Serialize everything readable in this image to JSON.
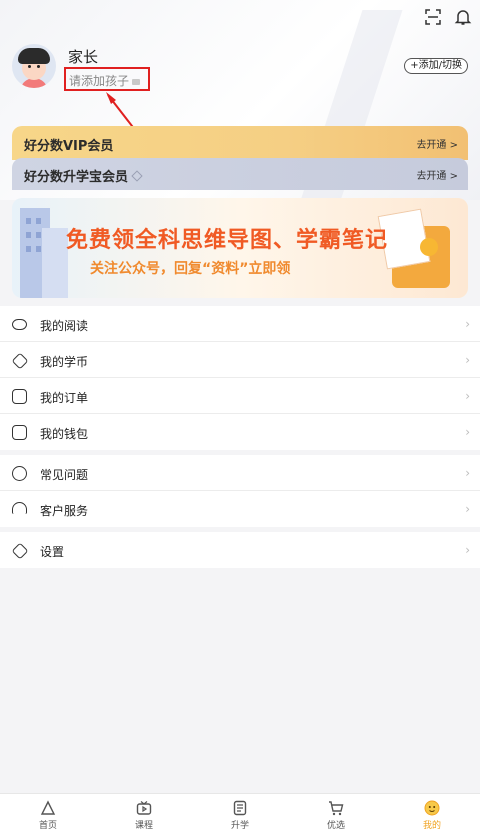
{
  "profile": {
    "name": "家长",
    "add_child_hint": "请添加孩子",
    "switch_button": "+添加/切换"
  },
  "vip": {
    "vip_title": "好分数VIP会员",
    "vip_action": "去开通 >",
    "shengxue_title": "好分数升学宝会员",
    "shengxue_action": "去开通 >"
  },
  "banner": {
    "headline": "免费领全科思维导图、学霸笔记",
    "subline": "关注公众号，回复“资料”立即领"
  },
  "menu_group1": [
    {
      "label": "我的阅读",
      "icon": "eye-icon"
    },
    {
      "label": "我的学币",
      "icon": "coin-icon"
    },
    {
      "label": "我的订单",
      "icon": "order-icon"
    },
    {
      "label": "我的钱包",
      "icon": "wallet-icon"
    }
  ],
  "menu_group2": [
    {
      "label": "常见问题",
      "icon": "question-icon"
    },
    {
      "label": "客户服务",
      "icon": "headset-icon"
    }
  ],
  "menu_group3": [
    {
      "label": "设置",
      "icon": "settings-icon"
    }
  ],
  "tabs": [
    {
      "label": "首页",
      "icon": "home-icon",
      "active": false
    },
    {
      "label": "课程",
      "icon": "course-tv-icon",
      "active": false
    },
    {
      "label": "升学",
      "icon": "document-icon",
      "active": false
    },
    {
      "label": "优选",
      "icon": "cart-icon",
      "active": false
    },
    {
      "label": "我的",
      "icon": "profile-icon",
      "active": true
    }
  ],
  "colors": {
    "accent": "#f0a322",
    "highlight_box": "#e02020",
    "vip_gold": "#f5cf84",
    "vip_silver": "#c6cbdc"
  }
}
